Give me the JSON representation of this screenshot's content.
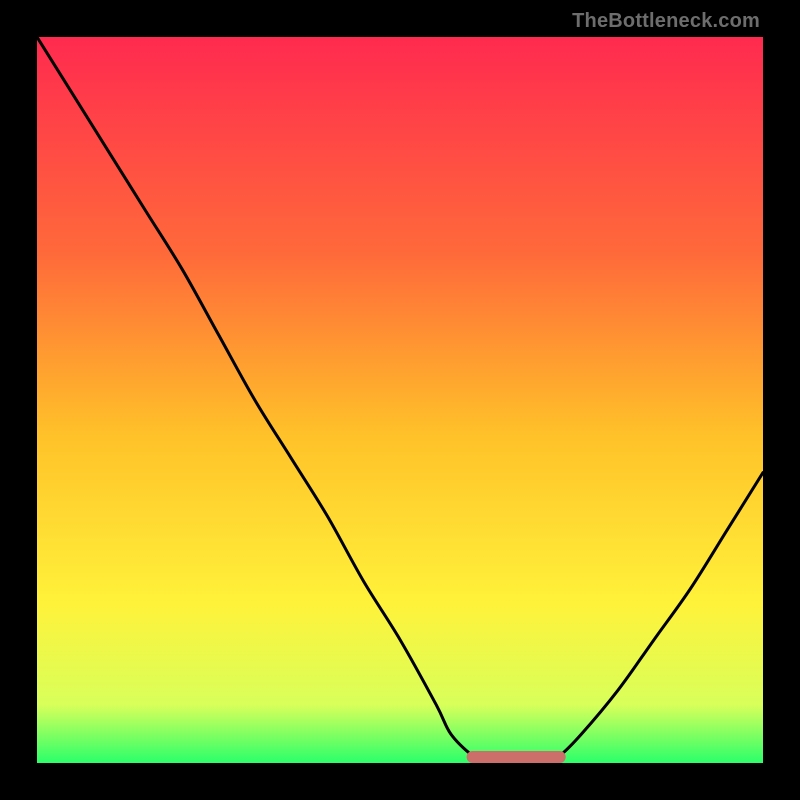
{
  "watermark": "TheBottleneck.com",
  "colors": {
    "black": "#000000",
    "grad_top": "#ff2a4f",
    "grad_mid1": "#ff6a3a",
    "grad_mid2": "#ffc229",
    "grad_mid3": "#fff23a",
    "grad_mid4": "#d8ff5a",
    "grad_bottom": "#2bff6a",
    "curve": "#000000",
    "accent_bar": "#cc6f6a"
  },
  "chart_data": {
    "type": "line",
    "title": "",
    "xlabel": "",
    "ylabel": "",
    "xlim": [
      0,
      100
    ],
    "ylim": [
      0,
      100
    ],
    "series": [
      {
        "name": "bottleneck-curve",
        "x": [
          0,
          5,
          10,
          15,
          20,
          25,
          30,
          35,
          40,
          45,
          50,
          55,
          57,
          60,
          62,
          65,
          68,
          70,
          72,
          75,
          80,
          85,
          90,
          95,
          100
        ],
        "y": [
          100,
          92,
          84,
          76,
          68,
          59,
          50,
          42,
          34,
          25,
          17,
          8,
          4,
          1,
          0,
          0,
          0,
          0,
          1,
          4,
          10,
          17,
          24,
          32,
          40
        ]
      }
    ],
    "annotations": [
      {
        "name": "flat-minimum-highlight",
        "x_range": [
          60,
          72
        ],
        "y": 0,
        "color_ref": "accent_bar"
      }
    ]
  }
}
